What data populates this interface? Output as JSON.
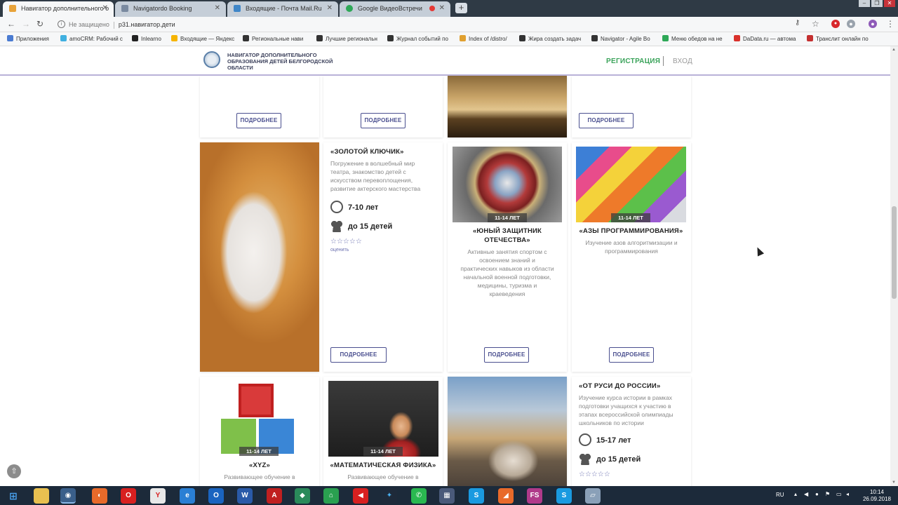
{
  "browser": {
    "tabs": [
      {
        "title": "Навигатор дополнительного о",
        "fav_color": "#e8a33a"
      },
      {
        "title": "Navigatordo Booking",
        "fav_color": "#7a8aa0"
      },
      {
        "title": "Входящие - Почта Mail.Ru",
        "fav_color": "#3f86c8"
      },
      {
        "title": "Google ВидеоВстречи",
        "fav_color": "#2ea857"
      }
    ],
    "security_label": "Не защищено",
    "url": "p31.навигатор.дети",
    "bookmarks": [
      {
        "label": "Приложения",
        "color": "#4a7bd1"
      },
      {
        "label": "amoCRM: Рабочий с",
        "color": "#40b0e0"
      },
      {
        "label": "Inlearno",
        "color": "#222222"
      },
      {
        "label": "Входящие — Яндекс",
        "color": "#f6b400"
      },
      {
        "label": "Региональные нави",
        "color": "#333333"
      },
      {
        "label": "Лучшие региональн",
        "color": "#333333"
      },
      {
        "label": "Журнал событий по",
        "color": "#333333"
      },
      {
        "label": "Index of /distro/",
        "color": "#e0a030"
      },
      {
        "label": "Жира создать задач",
        "color": "#333333"
      },
      {
        "label": "Navigator - Agile Bo",
        "color": "#333333"
      },
      {
        "label": "Меню обедов на не",
        "color": "#2ea857"
      },
      {
        "label": "DaData.ru — автома",
        "color": "#d9312b"
      },
      {
        "label": "Транслит онлайн по",
        "color": "#c43030"
      }
    ]
  },
  "site": {
    "logo_text": "НАВИГАТОР ДОПОЛНИТЕЛЬНОГО ОБРАЗОВАНИЯ ДЕТЕЙ БЕЛГОРОДСКОЙ ОБЛАСТИ",
    "register": "РЕГИСТРАЦИЯ",
    "login": "ВХОД",
    "more_label": "ПОДРОБНЕЕ",
    "rate_label": "оценить",
    "stars": "☆☆☆☆☆",
    "cards": {
      "golden_key": {
        "title": "«ЗОЛОТОЙ КЛЮЧИК»",
        "desc": "Погружение в волшебный мир театра, знакомство детей с искусством перевоплощения, развитие актерского мастерства",
        "age": "7-10 лет",
        "group": "до 15 детей"
      },
      "young_defender": {
        "title": "«ЮНЫЙ ЗАЩИТНИК ОТЕЧЕСТВА»",
        "desc": "Активные занятия спортом с освоением знаний и практических навыков из области начальной военной подготовки, медицины, туризма и краеведения",
        "badge": "11-14 ЛЕТ"
      },
      "programming": {
        "title": "«АЗЫ ПРОГРАММИРОВАНИЯ»",
        "desc": "Изучение азов алгоритмизации и программирования",
        "badge": "11-14 ЛЕТ"
      },
      "xyz": {
        "title": "«XYZ»",
        "desc": "Развивающее обучение в",
        "badge": "11-14 ЛЕТ"
      },
      "math_physics": {
        "title": "«МАТЕМАТИЧЕСКАЯ ФИЗИКА»",
        "desc": "Развивающее обучение в",
        "badge": "11-14 ЛЕТ"
      },
      "rus_russia": {
        "title": "«ОТ РУСИ ДО РОССИИ»",
        "desc": "Изучение курса истории в рамках подготовки учащихся к участию в этапах всероссийской олимпиады школьников по истории",
        "age": "15-17 лет",
        "group": "до 15 детей"
      }
    }
  },
  "taskbar": {
    "lang": "RU",
    "time": "10:14",
    "date": "26.09.2018"
  }
}
